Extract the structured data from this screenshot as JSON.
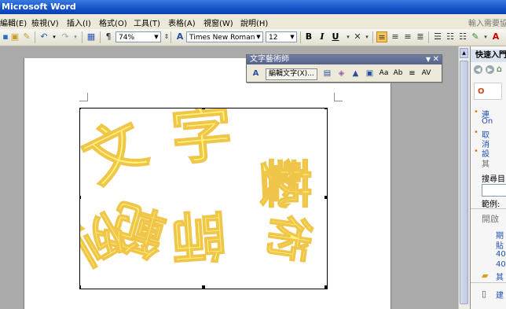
{
  "app": {
    "title": "Microsoft Word"
  },
  "menubar": {
    "items": [
      "編輯(E)",
      "檢視(V)",
      "插入(I)",
      "格式(O)",
      "工具(T)",
      "表格(A)",
      "視窗(W)",
      "說明(H)"
    ],
    "help_placeholder": "輸入需要協"
  },
  "toolbar": {
    "zoom": "74%",
    "font": "Times New Roman",
    "font_size": "12",
    "bold": "B",
    "italic": "I",
    "underline": "U"
  },
  "wordart_toolbar": {
    "title": "文字藝術師",
    "edit_text": "編輯文字(X)...",
    "btn_aa": "Aa",
    "btn_ab": "Ab",
    "btn_av": "AV"
  },
  "wordart": {
    "words": [
      "文",
      "字",
      "藝",
      "術",
      "師",
      "範",
      "例"
    ]
  },
  "taskpane": {
    "title": "快速入門",
    "search_label": "搜尋目",
    "example_label": "範例:",
    "open_label": "開啟",
    "links": [
      "連",
      "On",
      "取",
      "消",
      "設",
      "其"
    ],
    "file_items": [
      "期",
      "貼",
      "40",
      "40",
      "其",
      "建"
    ]
  },
  "colors": {
    "wordart_fill": "#FFF27A",
    "wordart_stroke": "#F0C64A",
    "titlebar": "#1552C9"
  }
}
